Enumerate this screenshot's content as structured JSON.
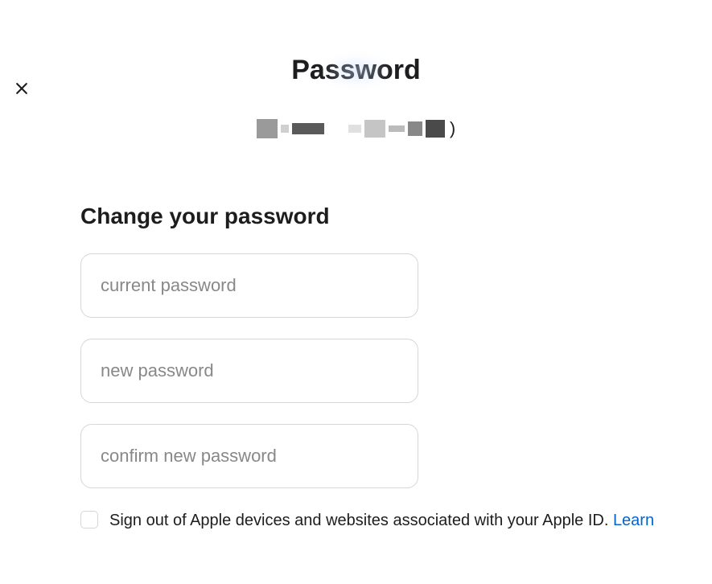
{
  "header": {
    "title": "Password",
    "username_redacted": true,
    "trailing_paren": ")"
  },
  "form": {
    "section_title": "Change your password",
    "current_password_placeholder": "current password",
    "new_password_placeholder": "new password",
    "confirm_password_placeholder": "confirm new password",
    "current_password_value": "",
    "new_password_value": "",
    "confirm_password_value": ""
  },
  "signout": {
    "label": "Sign out of Apple devices and websites associated with your Apple ID. ",
    "learn_link": "Learn",
    "checked": false
  },
  "colors": {
    "text_primary": "#1d1d1f",
    "placeholder": "#888888",
    "border": "#d6d6d6",
    "link": "#0066cc"
  }
}
